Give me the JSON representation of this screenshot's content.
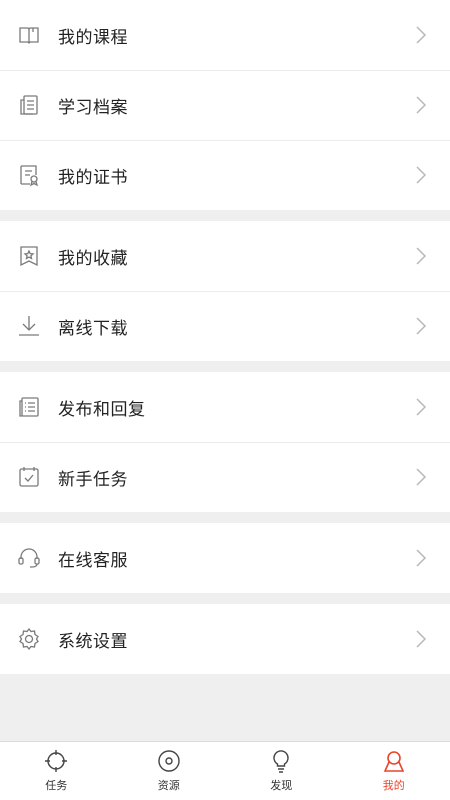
{
  "menu": {
    "groups": [
      {
        "items": [
          {
            "label": "我的课程",
            "icon": "book-icon"
          },
          {
            "label": "学习档案",
            "icon": "archive-icon"
          },
          {
            "label": "我的证书",
            "icon": "certificate-icon"
          }
        ]
      },
      {
        "items": [
          {
            "label": "我的收藏",
            "icon": "star-bookmark-icon"
          },
          {
            "label": "离线下载",
            "icon": "download-icon"
          }
        ]
      },
      {
        "items": [
          {
            "label": "发布和回复",
            "icon": "list-document-icon"
          },
          {
            "label": "新手任务",
            "icon": "calendar-check-icon"
          }
        ]
      },
      {
        "items": [
          {
            "label": "在线客服",
            "icon": "headset-icon"
          }
        ]
      },
      {
        "items": [
          {
            "label": "系统设置",
            "icon": "gear-icon"
          }
        ]
      }
    ]
  },
  "tabbar": {
    "tabs": [
      {
        "label": "任务",
        "icon": "crosshair-icon",
        "active": false
      },
      {
        "label": "资源",
        "icon": "disc-icon",
        "active": false
      },
      {
        "label": "发现",
        "icon": "lightbulb-icon",
        "active": false
      },
      {
        "label": "我的",
        "icon": "profile-icon",
        "active": true
      }
    ]
  },
  "colors": {
    "accent": "#e8452c",
    "icon": "#7a7a7a",
    "chevron": "#b8b8b8"
  }
}
